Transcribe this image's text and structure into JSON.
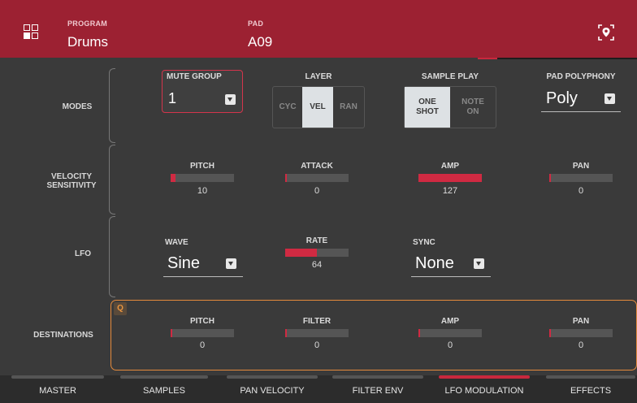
{
  "header": {
    "program_label": "PROGRAM",
    "program_value": "Drums",
    "pad_label": "PAD",
    "pad_value": "A09"
  },
  "modes": {
    "section_label": "MODES",
    "mute_group": {
      "label": "MUTE GROUP",
      "value": "1"
    },
    "layer": {
      "label": "LAYER",
      "options": [
        "CYC",
        "VEL",
        "RAN"
      ],
      "selected": "VEL"
    },
    "sample_play": {
      "label": "SAMPLE PLAY",
      "options": [
        "ONE SHOT",
        "NOTE ON"
      ],
      "selected": "ONE SHOT"
    },
    "pad_polyphony": {
      "label": "PAD POLYPHONY",
      "value": "Poly"
    }
  },
  "velocity": {
    "section_label_line1": "VELOCITY",
    "section_label_line2": "SENSITIVITY",
    "params": [
      {
        "label": "PITCH",
        "value": "10",
        "fraction": 0.08
      },
      {
        "label": "ATTACK",
        "value": "0",
        "fraction": 0.0
      },
      {
        "label": "AMP",
        "value": "127",
        "fraction": 1.0
      },
      {
        "label": "PAN",
        "value": "0",
        "fraction": 0.0
      }
    ]
  },
  "lfo": {
    "section_label": "LFO",
    "wave": {
      "label": "WAVE",
      "value": "Sine"
    },
    "rate": {
      "label": "RATE",
      "value": "64",
      "fraction": 0.5
    },
    "sync": {
      "label": "SYNC",
      "value": "None"
    }
  },
  "destinations": {
    "section_label": "DESTINATIONS",
    "badge": "Q",
    "params": [
      {
        "label": "PITCH",
        "value": "0",
        "fraction": 0.0
      },
      {
        "label": "FILTER",
        "value": "0",
        "fraction": 0.0
      },
      {
        "label": "AMP",
        "value": "0",
        "fraction": 0.0
      },
      {
        "label": "PAN",
        "value": "0",
        "fraction": 0.0
      }
    ]
  },
  "tabs": [
    {
      "label": "MASTER"
    },
    {
      "label": "SAMPLES"
    },
    {
      "label": "PAN VELOCITY"
    },
    {
      "label": "FILTER ENV"
    },
    {
      "label": "LFO MODULATION"
    },
    {
      "label": "EFFECTS"
    }
  ],
  "active_tab": "LFO MODULATION",
  "colors": {
    "accent": "#9c2132",
    "slider_fill": "#d02a42",
    "q_outline": "#e48a3c"
  },
  "icons": {
    "menu": "grid-icon",
    "locate": "pad-locate-icon"
  }
}
